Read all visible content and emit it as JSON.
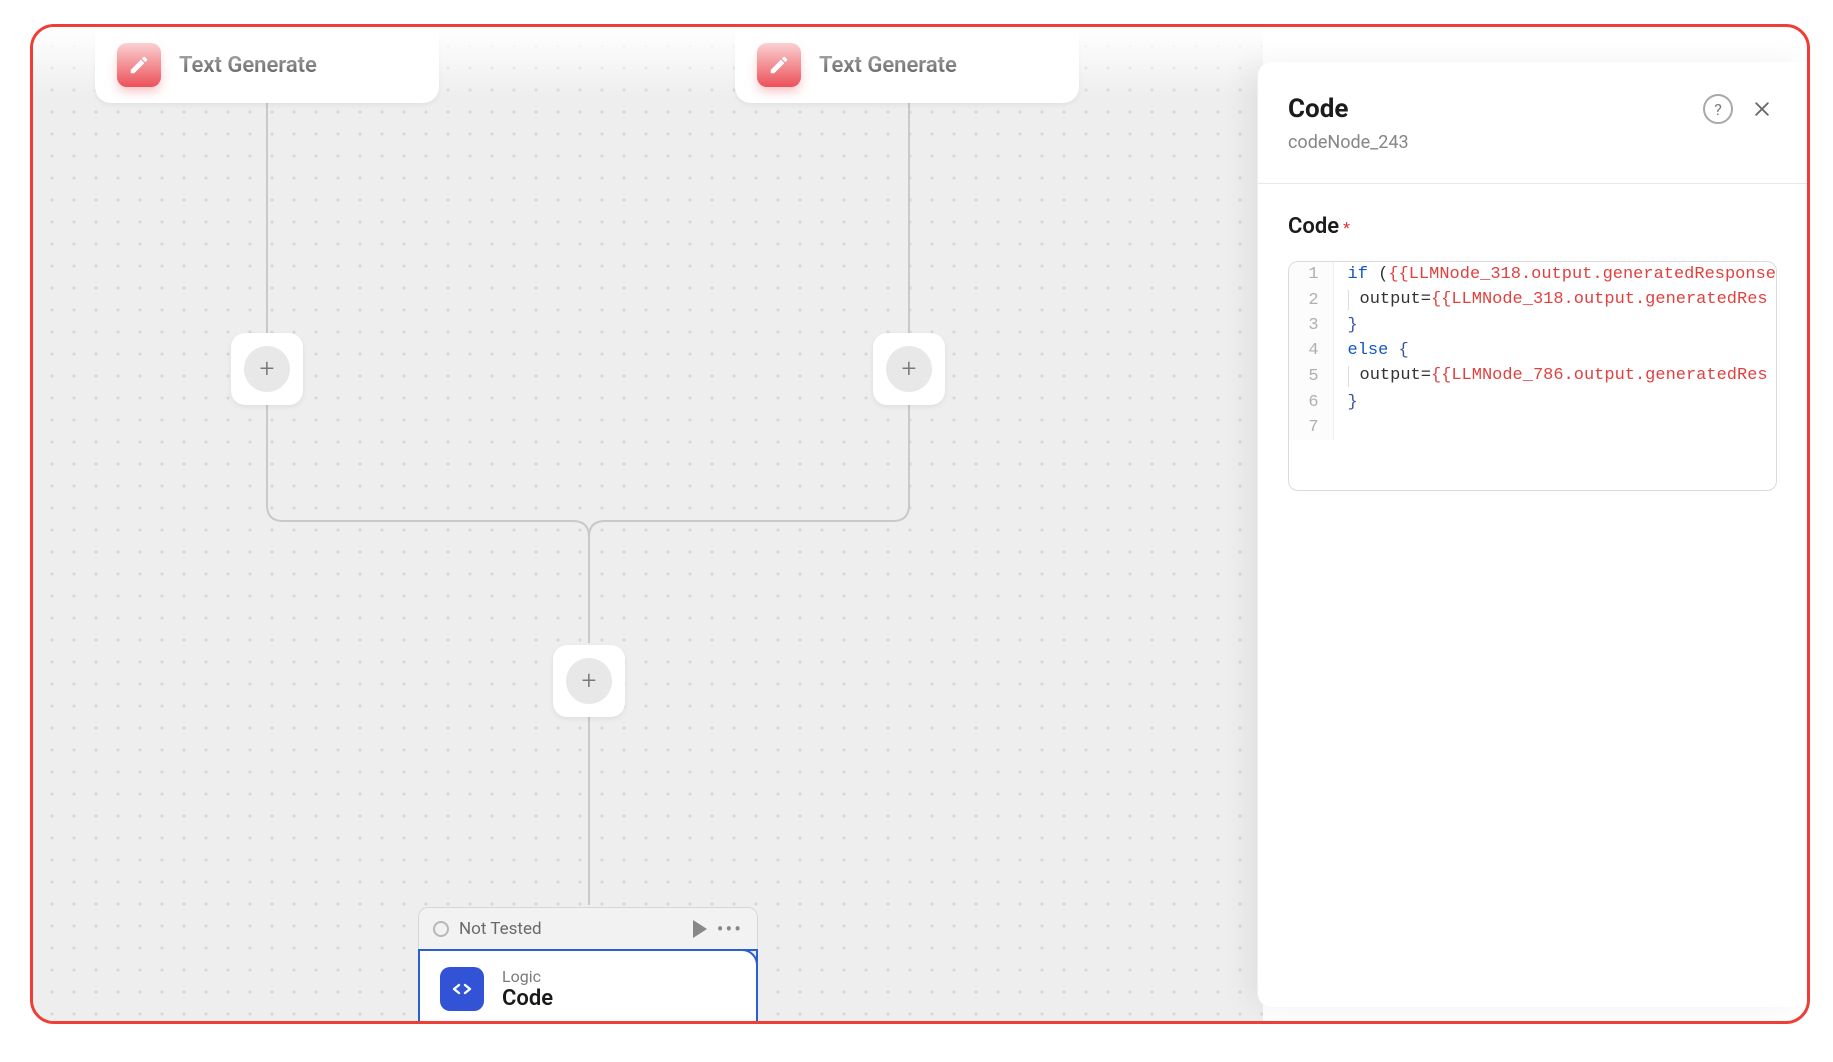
{
  "canvas": {
    "nodes": {
      "textgen1": {
        "label": "Text Generate"
      },
      "textgen2": {
        "label": "Text Generate"
      },
      "codeNode": {
        "status": "Not Tested",
        "category": "Logic",
        "title": "Code"
      }
    }
  },
  "panel": {
    "title": "Code",
    "subtitle": "codeNode_243",
    "section_label": "Code",
    "required_mark": "*",
    "code_lines": [
      {
        "n": 1,
        "tokens": [
          {
            "t": "kw",
            "v": "if"
          },
          {
            "t": "",
            "v": " ("
          },
          {
            "t": "var",
            "v": "{{LLMNode_318.output.generatedResponse"
          }
        ]
      },
      {
        "n": 2,
        "tokens": [
          {
            "t": "guide",
            "v": ""
          },
          {
            "t": "",
            "v": "output="
          },
          {
            "t": "var",
            "v": "{{LLMNode_318.output.generatedRes"
          }
        ]
      },
      {
        "n": 3,
        "tokens": [
          {
            "t": "pun",
            "v": "}"
          }
        ]
      },
      {
        "n": 4,
        "tokens": [
          {
            "t": "kw",
            "v": "else"
          },
          {
            "t": "",
            "v": " "
          },
          {
            "t": "pun",
            "v": "{"
          }
        ]
      },
      {
        "n": 5,
        "tokens": [
          {
            "t": "guide",
            "v": ""
          },
          {
            "t": "",
            "v": "output="
          },
          {
            "t": "var",
            "v": "{{LLMNode_786.output.generatedRes"
          }
        ]
      },
      {
        "n": 6,
        "tokens": [
          {
            "t": "pun",
            "v": "}"
          }
        ]
      },
      {
        "n": 7,
        "tokens": []
      }
    ]
  }
}
